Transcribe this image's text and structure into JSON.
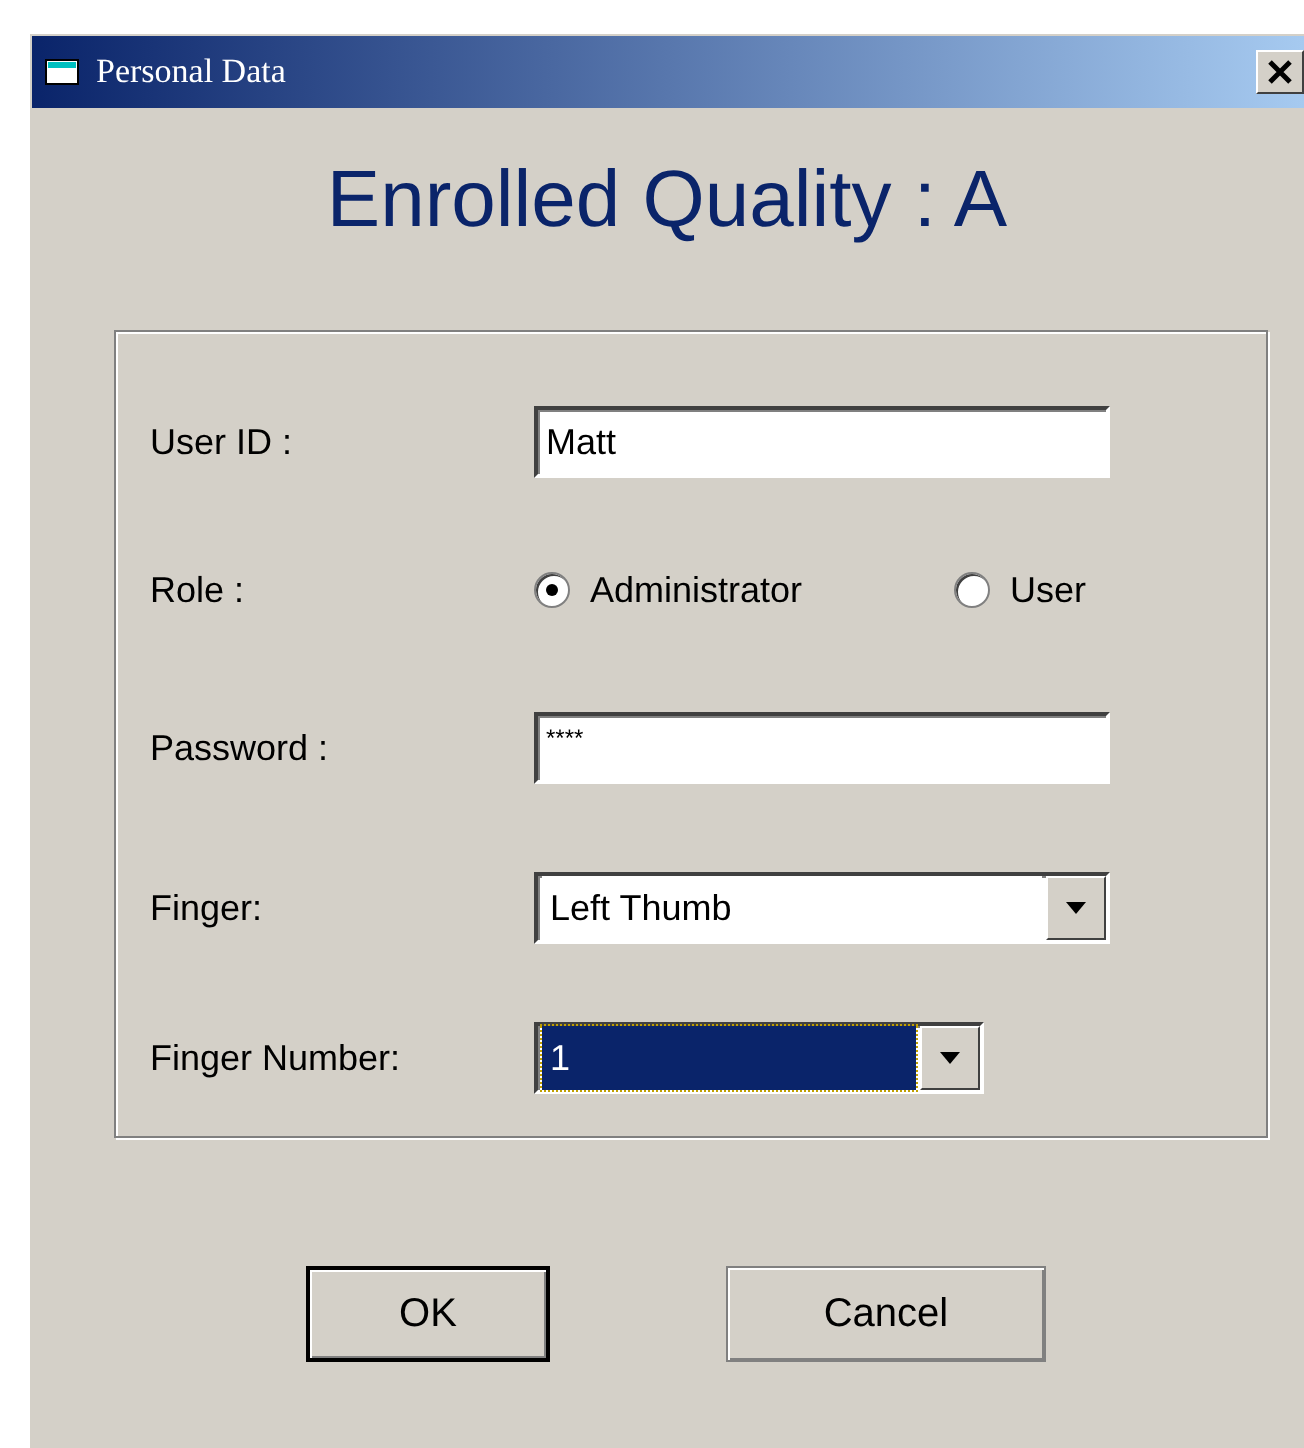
{
  "window": {
    "title": "Personal Data"
  },
  "heading": "Enrolled Quality : A",
  "fields": [
    {
      "kind": "text",
      "label": "User ID :",
      "value": "Matt"
    },
    {
      "kind": "radio",
      "label": "Role :",
      "options": [
        {
          "label": "Administrator",
          "selected": true
        },
        {
          "label": "User",
          "selected": false
        }
      ]
    },
    {
      "kind": "text",
      "label": "Password :",
      "value": "****"
    },
    {
      "kind": "dropdown",
      "label": "Finger:",
      "value": "Left Thumb",
      "focused": false
    },
    {
      "kind": "dropdown",
      "label": "Finger Number:",
      "value": "1",
      "focused": true
    }
  ],
  "buttons": [
    {
      "label": "OK",
      "default": true
    },
    {
      "label": "Cancel",
      "default": false
    }
  ]
}
